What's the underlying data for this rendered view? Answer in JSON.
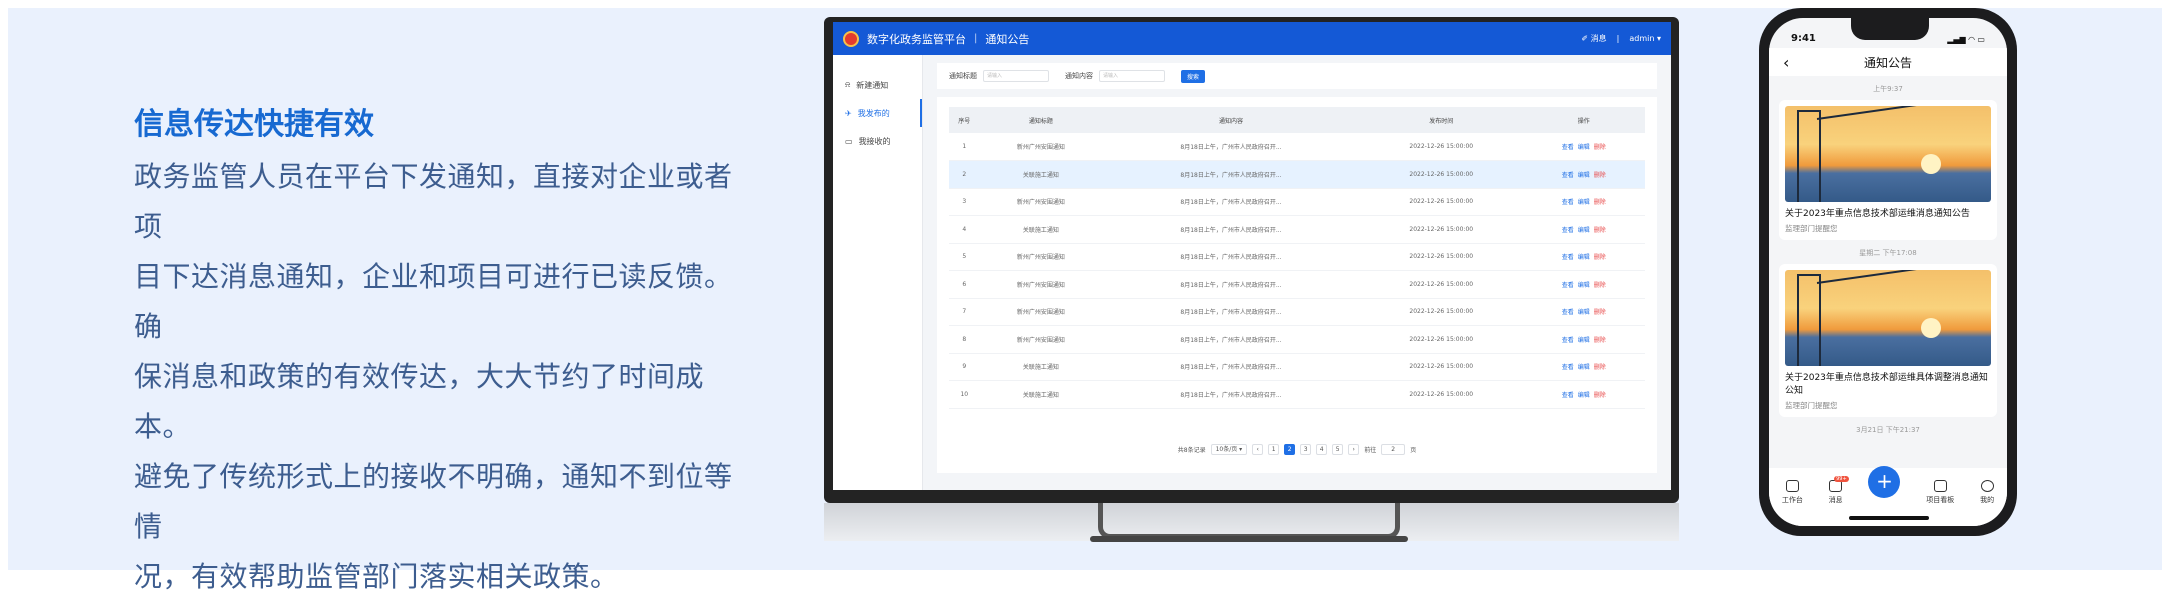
{
  "intro": {
    "heading": "信息传达快捷有效",
    "lines": [
      "政务监管人员在平台下发通知，直接对企业或者项",
      "目下达消息通知，企业和项目可进行已读反馈。确",
      "保消息和政策的有效传达，大大节约了时间成本。",
      "避免了传统形式上的接收不明确，通知不到位等情",
      "况，有效帮助监管部门落实相关政策。"
    ]
  },
  "web": {
    "app_title": "数字化政务监管平台",
    "page_title": "通知公告",
    "messages_label": "消息",
    "user": "admin",
    "sidebar": [
      {
        "label": "新建通知",
        "active": false
      },
      {
        "label": "我发布的",
        "active": true
      },
      {
        "label": "我接收的",
        "active": false
      }
    ],
    "filter": {
      "title_label": "通知标题",
      "title_placeholder": "请输入",
      "content_label": "通知内容",
      "content_placeholder": "请输入",
      "search_label": "搜索"
    },
    "columns": [
      "序号",
      "通知标题",
      "通知内容",
      "发布时间",
      "操作"
    ],
    "rows": [
      {
        "no": "1",
        "title": "新州广州安围通知",
        "content": "8月18日上午，广州市人民政府召开...",
        "time": "2022-12-26 15:00:00"
      },
      {
        "no": "2",
        "title": "关联施工通知",
        "content": "8月18日上午，广州市人民政府召开...",
        "time": "2022-12-26 15:00:00"
      },
      {
        "no": "3",
        "title": "新州广州安围通知",
        "content": "8月18日上午，广州市人民政府召开...",
        "time": "2022-12-26 15:00:00"
      },
      {
        "no": "4",
        "title": "关联施工通知",
        "content": "8月18日上午，广州市人民政府召开...",
        "time": "2022-12-26 15:00:00"
      },
      {
        "no": "5",
        "title": "新州广州安围通知",
        "content": "8月18日上午，广州市人民政府召开...",
        "time": "2022-12-26 15:00:00"
      },
      {
        "no": "6",
        "title": "新州广州安围通知",
        "content": "8月18日上午，广州市人民政府召开...",
        "time": "2022-12-26 15:00:00"
      },
      {
        "no": "7",
        "title": "新州广州安围通知",
        "content": "8月18日上午，广州市人民政府召开...",
        "time": "2022-12-26 15:00:00"
      },
      {
        "no": "8",
        "title": "新州广州安围通知",
        "content": "8月18日上午，广州市人民政府召开...",
        "time": "2022-12-26 15:00:00"
      },
      {
        "no": "9",
        "title": "关联施工通知",
        "content": "8月18日上午，广州市人民政府召开...",
        "time": "2022-12-26 15:00:00"
      },
      {
        "no": "10",
        "title": "关联施工通知",
        "content": "8月18日上午，广州市人民政府召开...",
        "time": "2022-12-26 15:00:00"
      }
    ],
    "ops": {
      "view": "查看",
      "edit": "编辑",
      "delete": "删除"
    },
    "highlight_row": 2,
    "pager": {
      "total": "共8条记录",
      "size": "10条/页",
      "pages": [
        "1",
        "2",
        "3",
        "4",
        "5"
      ],
      "current": "2",
      "goto_label": "前往",
      "goto_value": "2",
      "page_suffix": "页"
    }
  },
  "mobile": {
    "time": "9:41",
    "title": "通知公告",
    "notices": [
      {
        "time": "上午9:37",
        "title": "关于2023年重点信息技术部运维消息通知公告",
        "source": "监理部门提醒您"
      },
      {
        "time": "星期二 下午17:08",
        "title": "关于2023年重点信息技术部运维具体调整消息通知公知",
        "source": "监理部门提醒您"
      }
    ],
    "next_time": "3月21日 下午21:37",
    "tabs": [
      {
        "label": "工作台"
      },
      {
        "label": "消息",
        "badge": "99+"
      },
      {
        "label": "+"
      },
      {
        "label": "项目看板"
      },
      {
        "label": "我的"
      }
    ]
  },
  "colors": {
    "accent": "#1f6fe5",
    "header": "#1459d6",
    "heading": "#1769d1",
    "body_text": "#3d5d8f",
    "danger": "#e84a4a"
  }
}
